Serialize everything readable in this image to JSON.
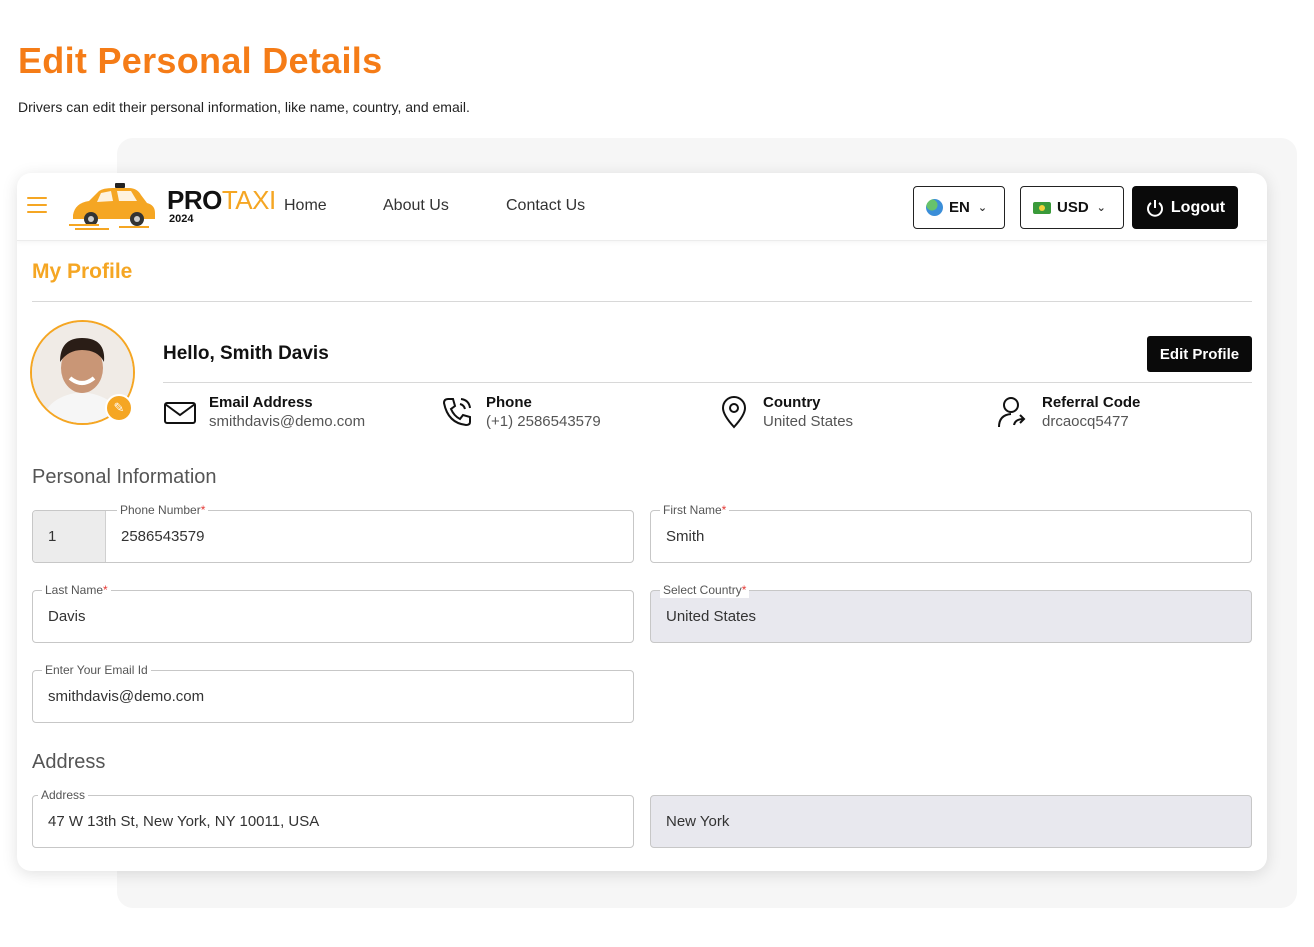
{
  "hero": {
    "title": "Edit Personal Details",
    "subtitle": "Drivers can edit their personal information, like name, country, and email."
  },
  "navbar": {
    "brand_pro": "PRO",
    "brand_taxi": "TAXI",
    "brand_year": "2024",
    "links": [
      "Home",
      "About Us",
      "Contact Us"
    ],
    "language": "EN",
    "currency": "USD",
    "logout_label": "Logout"
  },
  "profile": {
    "section_title": "My Profile",
    "greeting": "Hello, Smith Davis",
    "edit_button": "Edit Profile",
    "info": [
      {
        "icon": "mail-icon",
        "label": "Email Address",
        "value": "smithdavis@demo.com"
      },
      {
        "icon": "phone-icon",
        "label": "Phone",
        "value": "(+1) 2586543579"
      },
      {
        "icon": "location-pin-icon",
        "label": "Country",
        "value": "United States"
      },
      {
        "icon": "referral-user-icon",
        "label": "Referral Code",
        "value": "drcaocq5477"
      }
    ]
  },
  "personal_info": {
    "title": "Personal Information",
    "phone": {
      "label": "Phone Number",
      "code": "1",
      "value": "2586543579"
    },
    "first_name": {
      "label": "First Name",
      "value": "Smith"
    },
    "last_name": {
      "label": "Last Name",
      "value": "Davis"
    },
    "country": {
      "label": "Select Country",
      "value": "United States"
    },
    "email": {
      "label": "Enter Your Email Id",
      "value": "smithdavis@demo.com"
    }
  },
  "address": {
    "title": "Address",
    "address": {
      "label": "Address",
      "value": "47 W 13th St, New York, NY 10011, USA"
    },
    "city": {
      "value": "New York"
    }
  },
  "colors": {
    "accent_orange": "#f57c17",
    "brand_yellow": "#f5a623",
    "button_black": "#0a0a0a"
  }
}
